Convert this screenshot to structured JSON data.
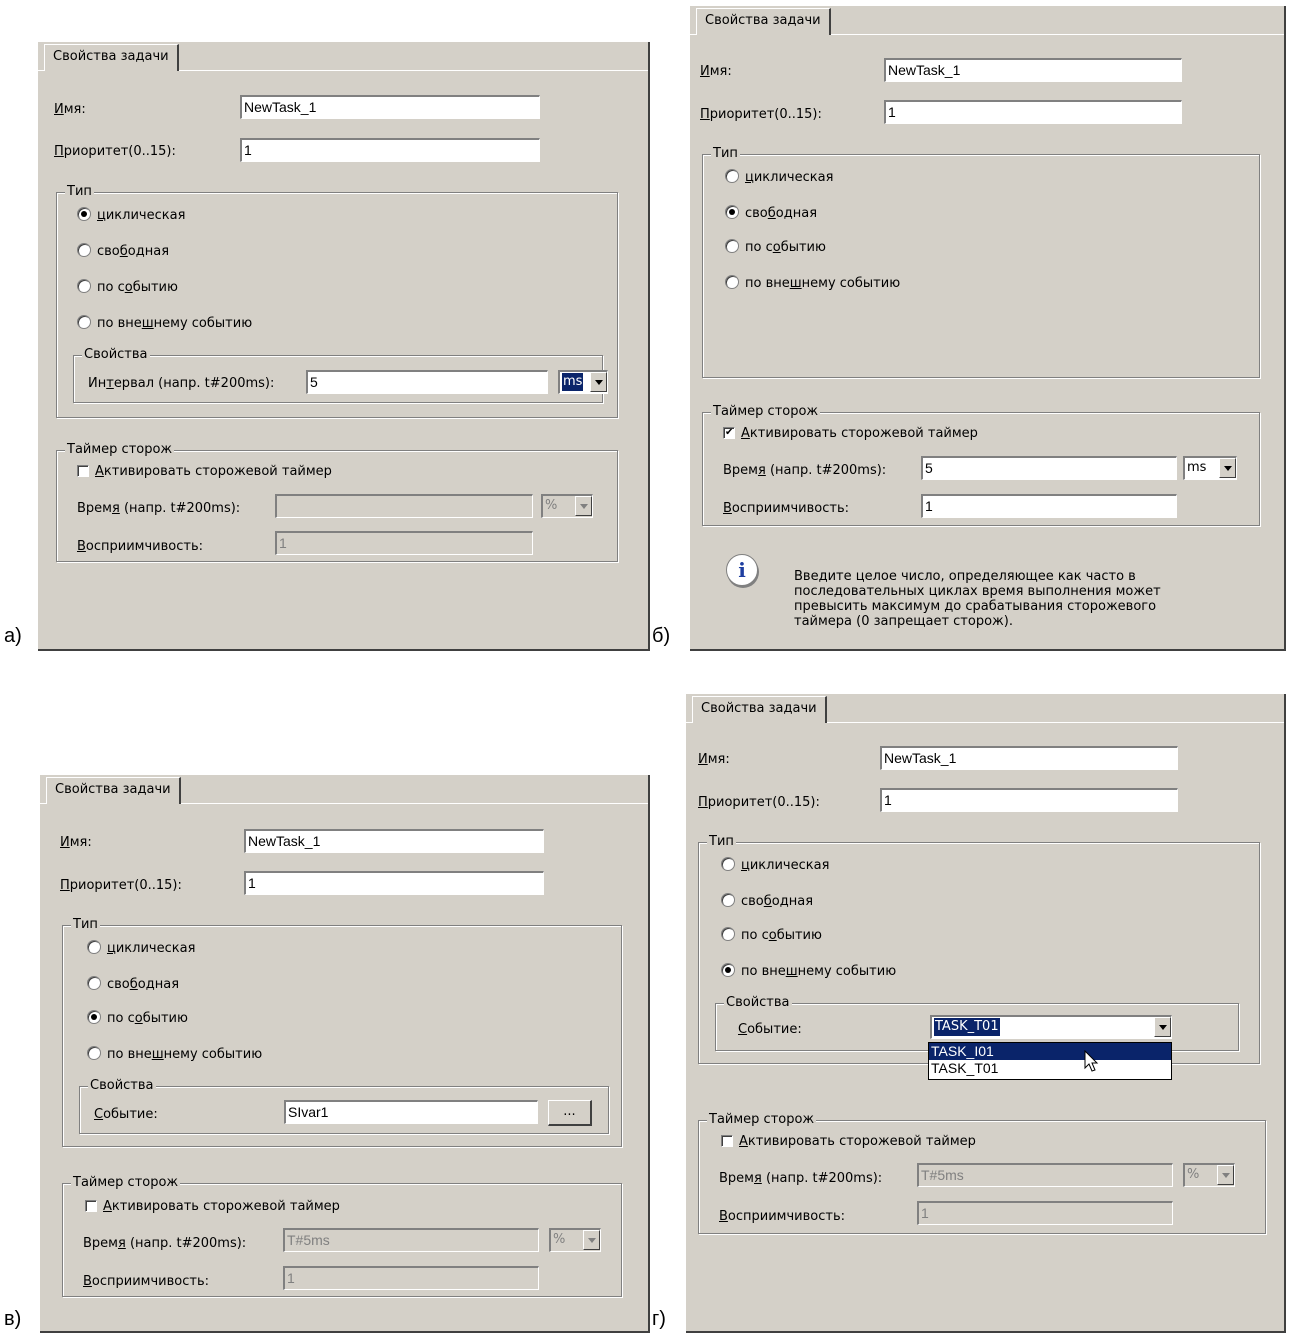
{
  "panels": {
    "a": {
      "letter": "а)",
      "tab": "Свойства задачи",
      "name_label": "Имя:",
      "name_value": "NewTask_1",
      "priority_label": "Приоритет(0..15):",
      "priority_value": "1",
      "type_group": "Тип",
      "types": [
        "циклическая",
        "свободная",
        "по событию",
        "по внешнему событию"
      ],
      "selected_type": 0,
      "props_group": "Свойства",
      "interval_label": "Интервал (напр. t#200ms):",
      "interval_value": "5",
      "interval_unit": "ms",
      "watchdog_group": "Таймер сторож",
      "watchdog_check": "Активировать сторожевой таймер",
      "watchdog_checked": false,
      "time_label": "Время (напр. t#200ms):",
      "time_value": "",
      "time_unit": "%",
      "sens_label": "Восприимчивость:",
      "sens_value": "1"
    },
    "b": {
      "letter": "б)",
      "tab": "Свойства задачи",
      "name_label": "Имя:",
      "name_value": "NewTask_1",
      "priority_label": "Приоритет(0..15):",
      "priority_value": "1",
      "type_group": "Тип",
      "types": [
        "циклическая",
        "свободная",
        "по событию",
        "по внешнему событию"
      ],
      "selected_type": 1,
      "watchdog_group": "Таймер сторож",
      "watchdog_check": "Активировать сторожевой таймер",
      "watchdog_checked": true,
      "time_label": "Время (напр. t#200ms):",
      "time_value": "5",
      "time_unit": "ms",
      "sens_label": "Восприимчивость:",
      "sens_value": "1",
      "info_text": "Введите целое число, определяющее как часто в последовательных циклах время выполнения может превысить максимум до срабатывания сторожевого таймера (0 запрещает сторож)."
    },
    "c": {
      "letter": "в)",
      "tab": "Свойства задачи",
      "name_label": "Имя:",
      "name_value": "NewTask_1",
      "priority_label": "Приоритет(0..15):",
      "priority_value": "1",
      "type_group": "Тип",
      "types": [
        "циклическая",
        "свободная",
        "по событию",
        "по внешнему событию"
      ],
      "selected_type": 2,
      "props_group": "Свойства",
      "event_label": "Событие:",
      "event_value": "SIvar1",
      "browse_label": "...",
      "watchdog_group": "Таймер сторож",
      "watchdog_check": "Активировать сторожевой таймер",
      "watchdog_checked": false,
      "time_label": "Время (напр. t#200ms):",
      "time_value": "T#5ms",
      "time_unit": "%",
      "sens_label": "Восприимчивость:",
      "sens_value": "1"
    },
    "d": {
      "letter": "г)",
      "tab": "Свойства задачи",
      "name_label": "Имя:",
      "name_value": "NewTask_1",
      "priority_label": "Приоритет(0..15):",
      "priority_value": "1",
      "type_group": "Тип",
      "types": [
        "циклическая",
        "свободная",
        "по событию",
        "по внешнему событию"
      ],
      "selected_type": 3,
      "props_group": "Свойства",
      "event_label": "Событие:",
      "event_value": "TASK_T01",
      "event_options": [
        "TASK_I01",
        "TASK_T01"
      ],
      "highlighted_option": 0,
      "watchdog_group": "Таймер сторож",
      "watchdog_check": "Активировать сторожевой таймер",
      "watchdog_checked": false,
      "time_label": "Время (напр. t#200ms):",
      "time_value": "T#5ms",
      "time_unit": "%",
      "sens_label": "Восприимчивость:",
      "sens_value": "1"
    }
  }
}
